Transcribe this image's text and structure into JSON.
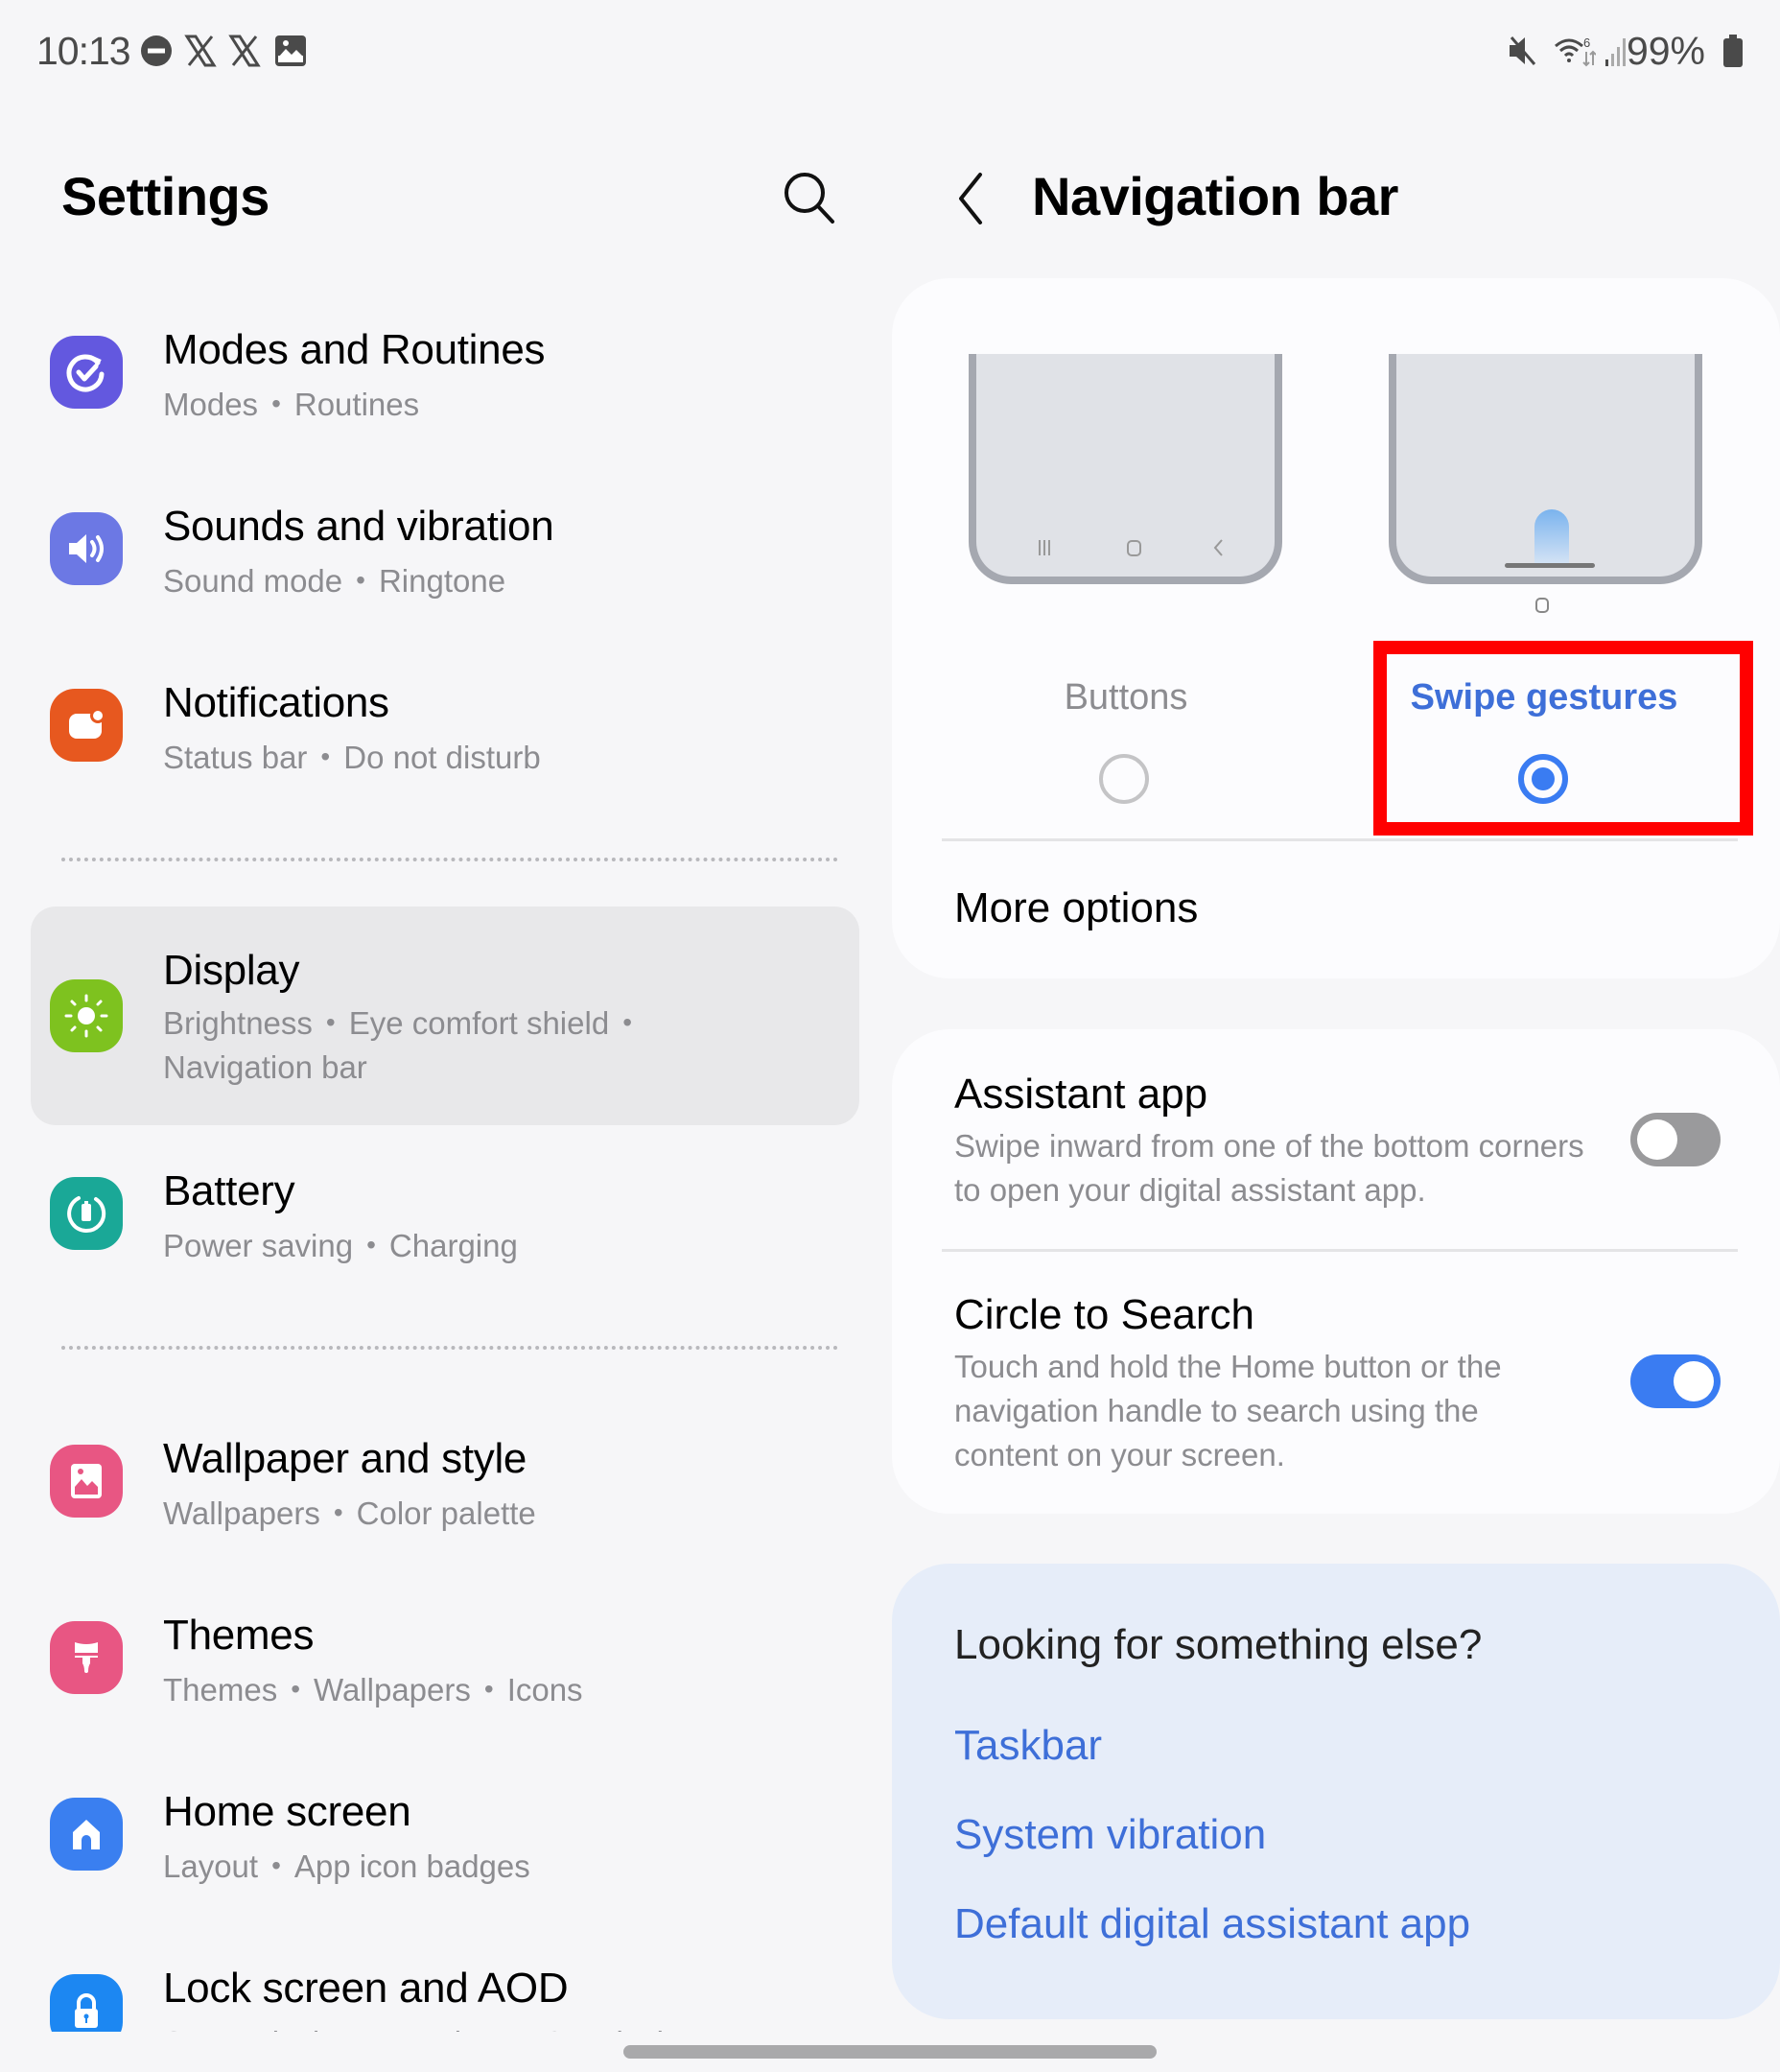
{
  "status_bar": {
    "time": "10:13",
    "left_icons": [
      "do-not-disturb-icon",
      "x-app-icon",
      "x-app-icon",
      "gallery-icon"
    ],
    "right_icons": [
      "mute-icon",
      "wifi-6-icon",
      "signal-icon",
      "battery-icon"
    ],
    "battery_percent": "99%"
  },
  "settings_panel": {
    "title": "Settings",
    "search_icon": "search-icon",
    "items": [
      {
        "title": "Modes and Routines",
        "subtitle": [
          "Modes",
          "Routines"
        ],
        "icon": "modes-routines-icon",
        "color": "#6358df"
      },
      {
        "title": "Sounds and vibration",
        "subtitle": [
          "Sound mode",
          "Ringtone"
        ],
        "icon": "speaker-icon",
        "color": "#6c78e4"
      },
      {
        "title": "Notifications",
        "subtitle": [
          "Status bar",
          "Do not disturb"
        ],
        "icon": "notification-icon",
        "color": "#e7581f"
      },
      {
        "title": "Display",
        "subtitle": [
          "Brightness",
          "Eye comfort shield",
          "Navigation bar"
        ],
        "icon": "sun-icon",
        "color": "#7ec21f",
        "selected": true
      },
      {
        "title": "Battery",
        "subtitle": [
          "Power saving",
          "Charging"
        ],
        "icon": "battery-care-icon",
        "color": "#1aa897"
      },
      {
        "title": "Wallpaper and style",
        "subtitle": [
          "Wallpapers",
          "Color palette"
        ],
        "icon": "wallpaper-icon",
        "color": "#e85683"
      },
      {
        "title": "Themes",
        "subtitle": [
          "Themes",
          "Wallpapers",
          "Icons"
        ],
        "icon": "paintbrush-icon",
        "color": "#e85683"
      },
      {
        "title": "Home screen",
        "subtitle": [
          "Layout",
          "App icon badges"
        ],
        "icon": "home-icon",
        "color": "#3a7ff0"
      },
      {
        "title": "Lock screen and AOD",
        "subtitle": [
          "Screen lock type",
          "Always On Display"
        ],
        "icon": "lock-icon",
        "color": "#1c87f2"
      }
    ]
  },
  "navigation_panel": {
    "title": "Navigation bar",
    "back_icon": "chevron-left-icon",
    "nav_type": {
      "options": [
        {
          "label": "Buttons",
          "selected": false
        },
        {
          "label": "Swipe gestures",
          "selected": true
        }
      ],
      "accent": "#3a7cf2"
    },
    "more_options": "More options",
    "assistant_app": {
      "title": "Assistant app",
      "description": "Swipe inward from one of the bottom corners to open your digital assistant app.",
      "enabled": false
    },
    "circle_to_search": {
      "title": "Circle to Search",
      "description": "Touch and hold the Home button or the navigation handle to search using the content on your screen.",
      "enabled": true
    },
    "suggestions": {
      "heading": "Looking for something else?",
      "links": [
        "Taskbar",
        "System vibration",
        "Default digital assistant app"
      ]
    }
  },
  "annotation": {
    "highlight_color": "#ff0000",
    "target": "Swipe gestures"
  }
}
